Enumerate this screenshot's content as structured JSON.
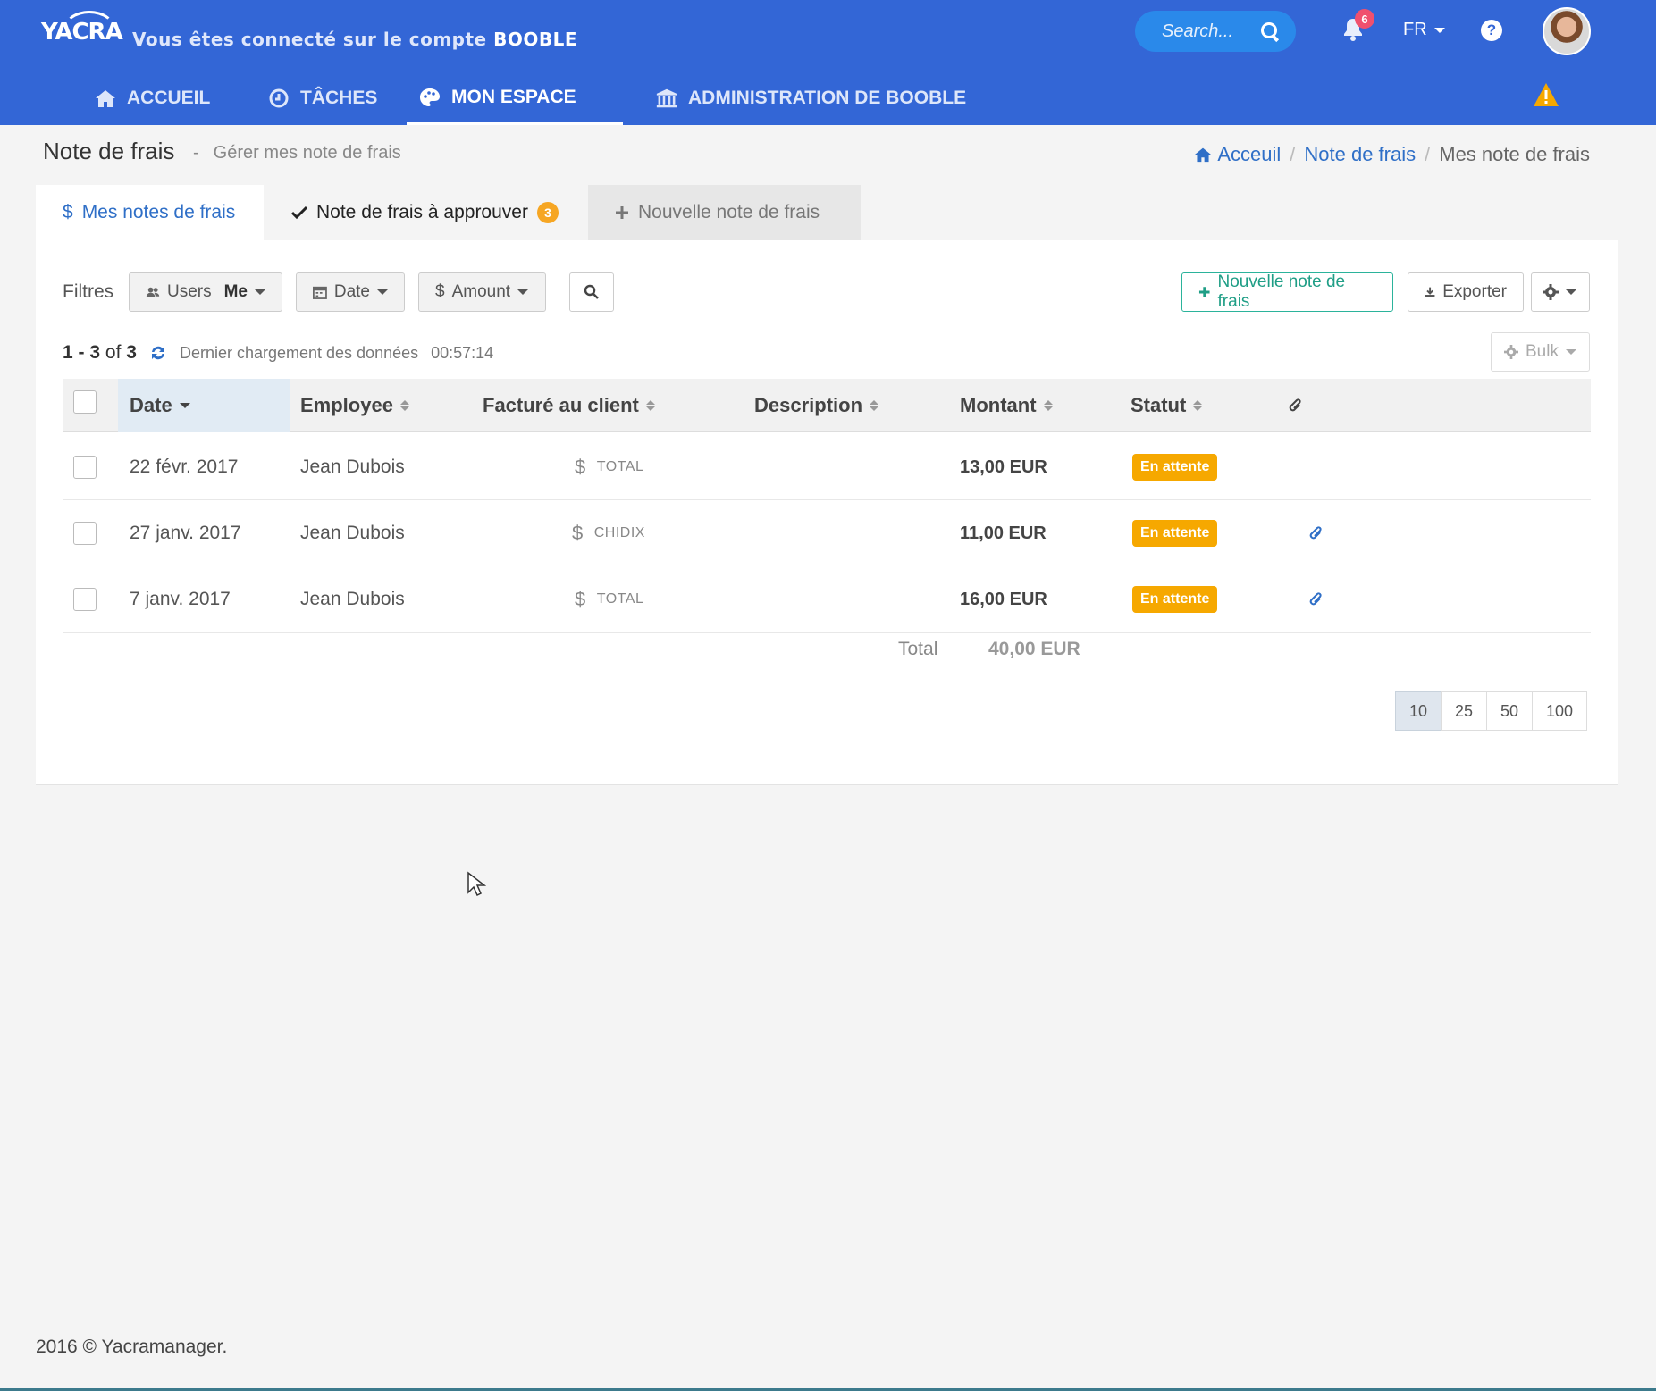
{
  "header": {
    "logo_text": "YACRA",
    "account_prefix": "Vous êtes connecté sur le compte",
    "account_name": "BOOBLE",
    "search_placeholder": "Search...",
    "notification_count": "6",
    "language": "FR",
    "help_label": "?"
  },
  "nav": [
    {
      "label": "ACCUEIL",
      "icon": "home-icon"
    },
    {
      "label": "TÂCHES",
      "icon": "clock-icon"
    },
    {
      "label": "MON ESPACE",
      "icon": "palette-icon",
      "active": true
    },
    {
      "label": "ADMINISTRATION DE BOOBLE",
      "icon": "bank-icon"
    }
  ],
  "page": {
    "title": "Note de frais",
    "dash": "-",
    "subtitle": "Gérer mes note de frais"
  },
  "breadcrumb": {
    "home": "Acceuil",
    "sep": "/",
    "level2": "Note de frais",
    "current": "Mes note de frais"
  },
  "tabs": {
    "mine_icon": "$",
    "mine": "Mes notes de frais",
    "approve": "Note de frais à approuver",
    "approve_badge": "3",
    "new": "Nouvelle note de frais"
  },
  "filters": {
    "label": "Filtres",
    "users": "Users",
    "users_value": "Me",
    "date": "Date",
    "amount": "Amount"
  },
  "actions": {
    "new": "Nouvelle note de frais",
    "export": "Exporter",
    "bulk": "Bulk"
  },
  "list_info": {
    "range_start": "1",
    "range_dash": "-",
    "range_end": "3",
    "of": "of",
    "total": "3",
    "last_load_label": "Dernier chargement des données",
    "last_load_time": "00:57:14"
  },
  "table": {
    "columns": [
      "Date",
      "Employee",
      "Facturé au client",
      "Description",
      "Montant",
      "Statut"
    ],
    "rows": [
      {
        "date": "22 févr. 2017",
        "employee": "Jean Dubois",
        "client": "TOTAL",
        "description": "",
        "amount": "13,00 EUR",
        "status": "En attente",
        "attachment": false
      },
      {
        "date": "27 janv. 2017",
        "employee": "Jean Dubois",
        "client": "CHIDIX",
        "description": "",
        "amount": "11,00 EUR",
        "status": "En attente",
        "attachment": true
      },
      {
        "date": "7 janv. 2017",
        "employee": "Jean Dubois",
        "client": "TOTAL",
        "description": "",
        "amount": "16,00 EUR",
        "status": "En attente",
        "attachment": true
      }
    ],
    "total_label": "Total",
    "total_value": "40,00 EUR"
  },
  "pagination": [
    "10",
    "25",
    "50",
    "100"
  ],
  "footer": "2016 © Yacramanager.",
  "colors": {
    "header": "#3366d6",
    "status_pending": "#f6a800",
    "accent_green": "#2bb39b",
    "link": "#2f6fc7"
  }
}
